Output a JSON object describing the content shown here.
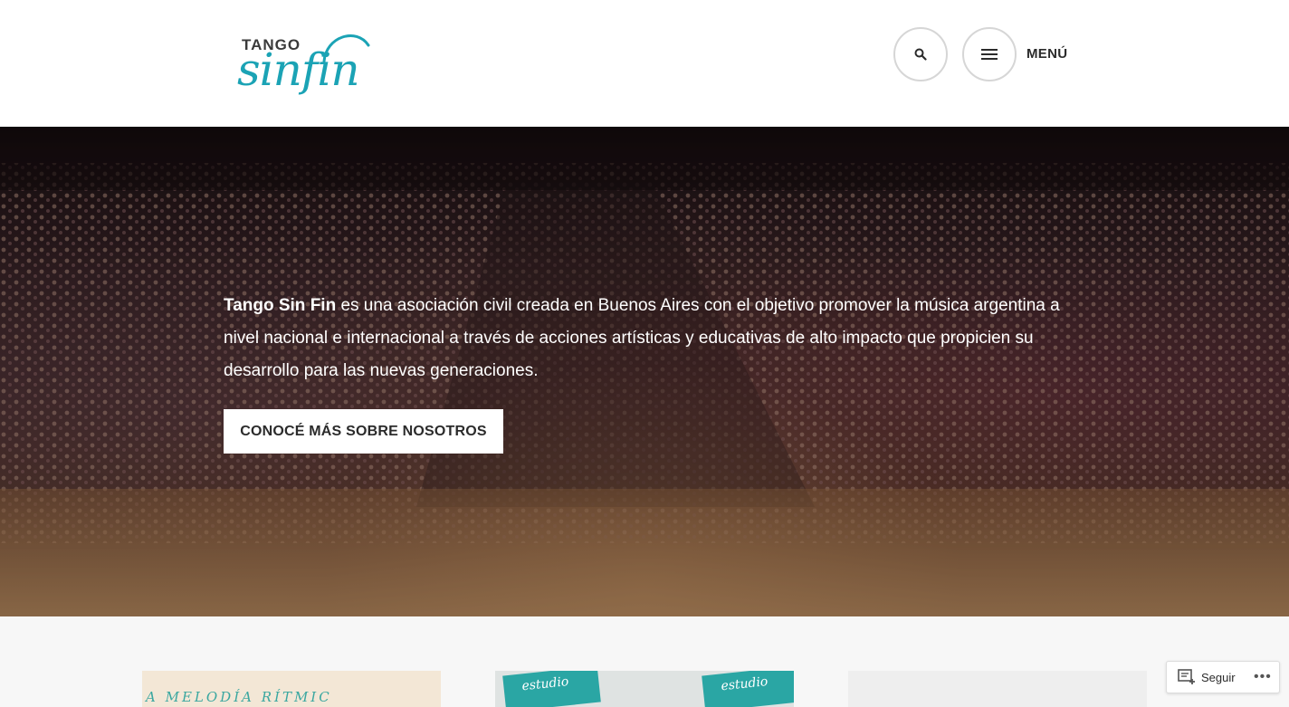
{
  "header": {
    "logo_small": "TANGO",
    "logo_big": "sinfin",
    "menu_label": "MENÚ",
    "icons": {
      "search": "search-icon",
      "menu": "hamburger-icon"
    }
  },
  "hero": {
    "text_bold": "Tango Sin Fin",
    "text_rest": " es una asociación civil creada en Buenos Aires con el objetivo promover la música argentina a nivel nacional e internacional a través de acciones artísticas y educativas de alto impacto que propicien su desarrollo para las nuevas generaciones.",
    "cta_label": "CONOCÉ MÁS SOBRE NOSOTROS"
  },
  "cards": [
    {
      "visible_text": "A MELODÍA RÍTMIC"
    },
    {
      "visible_text": "estudio"
    },
    {
      "visible_text": ""
    }
  ],
  "follow": {
    "label": "Seguir",
    "more": "•••"
  },
  "colors": {
    "brand_teal": "#1ba3b5",
    "text_dark": "#2b2b2b",
    "header_bg": "#ffffff",
    "page_bg": "#f7f7f7"
  }
}
